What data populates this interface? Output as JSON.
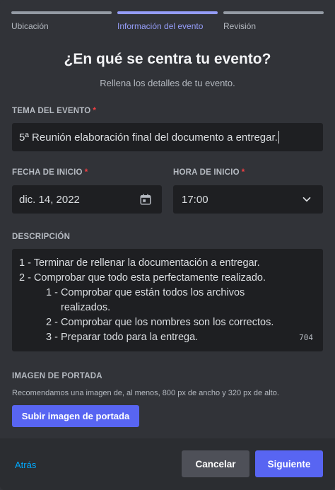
{
  "steps": [
    {
      "label": "Ubicación",
      "active": false
    },
    {
      "label": "Información del evento",
      "active": true
    },
    {
      "label": "Revisión",
      "active": false
    }
  ],
  "header": {
    "title": "¿En qué se centra tu evento?",
    "subtitle": "Rellena los detalles de tu evento."
  },
  "topic": {
    "label": "TEMA DEL EVENTO",
    "required_mark": "*",
    "value": "5ª Reunión elaboración final del documento a entregar."
  },
  "start_date": {
    "label": "FECHA DE INICIO",
    "required_mark": "*",
    "value": "dic. 14, 2022",
    "icon": "calendar-icon"
  },
  "start_time": {
    "label": "HORA DE INICIO",
    "required_mark": "*",
    "value": "17:00",
    "icon": "chevron-down-icon"
  },
  "description": {
    "label": "DESCRIPCIÓN",
    "lines": [
      "1 - Terminar de rellenar la documentación a entregar.",
      "2 - Comprobar que todo esta perfectamente realizado.",
      "1 - Comprobar que están todos los archivos",
      "realizados.",
      "2 - Comprobar que los nombres son los correctos.",
      "3 - Preparar todo para la entrega."
    ],
    "char_counter": "704"
  },
  "cover": {
    "label": "IMAGEN DE PORTADA",
    "hint": "Recomendamos una imagen de, al menos, 800 px de ancho y 320 px de alto.",
    "upload_button": "Subir imagen de portada"
  },
  "footer": {
    "back": "Atrás",
    "cancel": "Cancelar",
    "next": "Siguiente"
  },
  "colors": {
    "accent": "#5865f2",
    "active_step": "#949cf7",
    "required": "#f23f43",
    "link": "#00a8fc"
  }
}
